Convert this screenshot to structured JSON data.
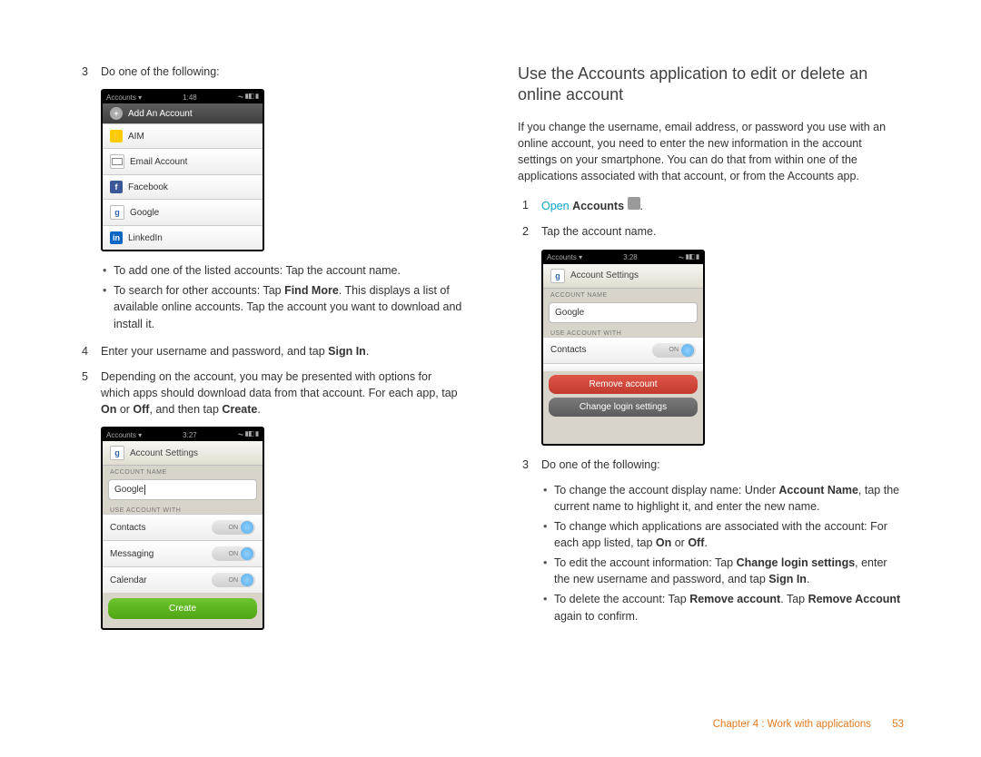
{
  "left": {
    "step3_num": "3",
    "step3_text": "Do one of the following:",
    "phone1": {
      "bar_left": "Accounts ▾",
      "bar_time": "1:48",
      "header": "Add An Account",
      "rows": [
        "AIM",
        "Email Account",
        "Facebook",
        "Google",
        "LinkedIn"
      ]
    },
    "bullet_a1_prefix": "To add one of the listed accounts: Tap the account name.",
    "bullet_a2_prefix": "To search for other accounts: Tap ",
    "bullet_a2_bold": "Find More",
    "bullet_a2_suffix": ". This displays a list of available online accounts. Tap the account you want to download and install it.",
    "step4_num": "4",
    "step4_prefix": "Enter your username and password, and tap ",
    "step4_bold": "Sign In",
    "step4_suffix": ".",
    "step5_num": "5",
    "step5_prefix": "Depending on the account, you may be presented with options for which apps should download data from that account. For each app, tap ",
    "step5_b1": "On",
    "step5_mid1": " or ",
    "step5_b2": "Off",
    "step5_mid2": ", and then tap ",
    "step5_b3": "Create",
    "step5_suffix": ".",
    "phone2": {
      "bar_left": "Accounts ▾",
      "bar_time": "3:27",
      "title": "Account Settings",
      "sect1": "ACCOUNT NAME",
      "name_val": "Google",
      "sect2": "USE ACCOUNT WITH",
      "r1": "Contacts",
      "r2": "Messaging",
      "r3": "Calendar",
      "toggle": "ON",
      "create": "Create"
    }
  },
  "right": {
    "heading": "Use the Accounts application to edit or delete an online account",
    "intro": "If you change the username, email address, or password you use with an online account, you need to enter the new information in the account settings on your smartphone. You can do that from within one of the applications associated with that account, or from the Accounts app.",
    "step1_num": "1",
    "step1_link": "Open",
    "step1_bold": "Accounts",
    "step1_suffix": ".",
    "step2_num": "2",
    "step2_text": "Tap the account name.",
    "phone3": {
      "bar_left": "Accounts ▾",
      "bar_time": "3:28",
      "title": "Account Settings",
      "sect1": "ACCOUNT NAME",
      "name_val": "Google",
      "sect2": "USE ACCOUNT WITH",
      "r1": "Contacts",
      "toggle": "ON",
      "remove": "Remove account",
      "change": "Change login settings"
    },
    "step3_num": "3",
    "step3_text": "Do one of the following:",
    "b1_prefix": "To change the account display name: Under ",
    "b1_bold": "Account Name",
    "b1_suffix": ", tap the current name to highlight it, and enter the new name.",
    "b2_prefix": "To change which applications are associated with the account: For each app listed, tap ",
    "b2_b1": "On",
    "b2_mid": " or ",
    "b2_b2": "Off",
    "b2_suffix": ".",
    "b3_prefix": "To edit the account information: Tap ",
    "b3_bold1": "Change login settings",
    "b3_mid": ", enter the new username and password, and tap ",
    "b3_bold2": "Sign In",
    "b3_suffix": ".",
    "b4_prefix": "To delete the account: Tap ",
    "b4_bold1": "Remove account",
    "b4_mid": ". Tap ",
    "b4_bold2": "Remove Account",
    "b4_suffix": " again to confirm."
  },
  "footer": {
    "chapter": "Chapter 4 : Work with applications",
    "page": "53"
  }
}
